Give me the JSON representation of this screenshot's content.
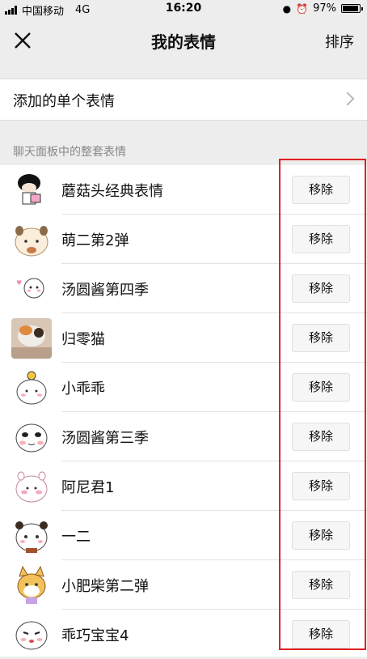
{
  "statusbar": {
    "carrier": "中国移动",
    "network": "4G",
    "time": "16:20",
    "battery": "97%",
    "battery_level": 0.97
  },
  "navbar": {
    "title": "我的表情",
    "sort_label": "排序"
  },
  "single": {
    "label": "添加的单个表情"
  },
  "section": {
    "header": "聊天面板中的整套表情"
  },
  "remove_label": "移除",
  "items": [
    {
      "name": "蘑菇头经典表情",
      "icon": "mushroom-head-sticker-icon"
    },
    {
      "name": "萌二第2弹",
      "icon": "meng-er-sticker-icon"
    },
    {
      "name": "汤圆酱第四季",
      "icon": "tangyuan-sticker-icon"
    },
    {
      "name": "归零猫",
      "icon": "cat-photo-sticker-icon"
    },
    {
      "name": "小乖乖",
      "icon": "xiaoguaiguai-sticker-icon"
    },
    {
      "name": "汤圆酱第三季",
      "icon": "tangyuan-s3-sticker-icon"
    },
    {
      "name": "阿尼君1",
      "icon": "anijun-sticker-icon"
    },
    {
      "name": "一二",
      "icon": "panda-yier-sticker-icon"
    },
    {
      "name": "小肥柴第二弹",
      "icon": "shiba-sticker-icon"
    },
    {
      "name": "乖巧宝宝4",
      "icon": "baby-sticker-icon"
    }
  ],
  "colors": {
    "highlight": "#e02020",
    "background": "#ededed"
  }
}
